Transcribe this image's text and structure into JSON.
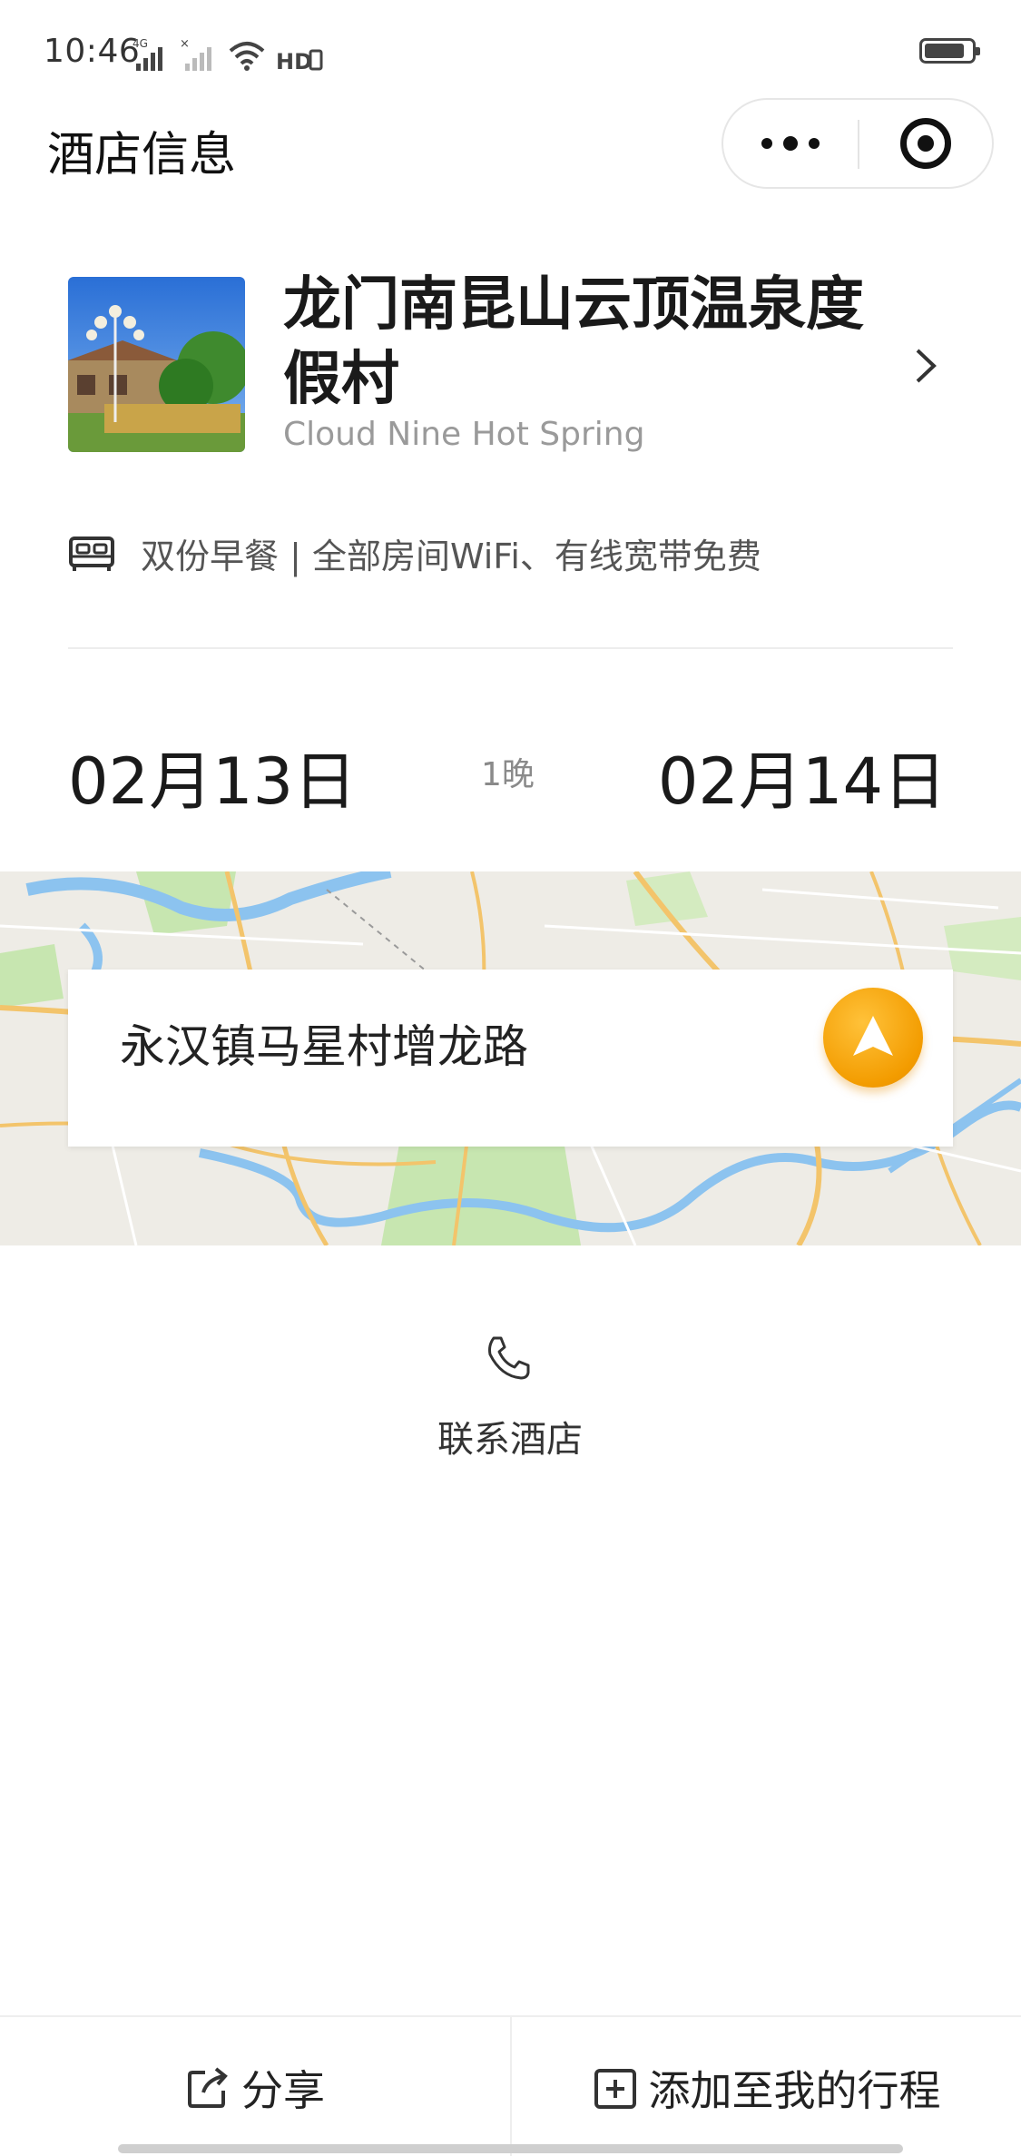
{
  "status_bar": {
    "time": "10:46",
    "network": "4G",
    "hd": "HD",
    "battery_level": 0.85
  },
  "nav": {
    "title": "酒店信息"
  },
  "hotel": {
    "name": "龙门南昆山云顶温泉度假村",
    "name_en": "Cloud Nine Hot Spring",
    "amenities": "双份早餐 | 全部房间WiFi、有线宽带免费"
  },
  "stay": {
    "check_in": "02月13日",
    "nights": "1晚",
    "check_out": "02月14日"
  },
  "map": {
    "address": "永汉镇马星村增龙路"
  },
  "contact": {
    "label": "联系酒店"
  },
  "bottom": {
    "share_label": "分享",
    "add_label": "添加至我的行程"
  },
  "colors": {
    "accent": "#f5a300",
    "text_primary": "#1a1a1a",
    "text_secondary": "#9a9a9a"
  }
}
